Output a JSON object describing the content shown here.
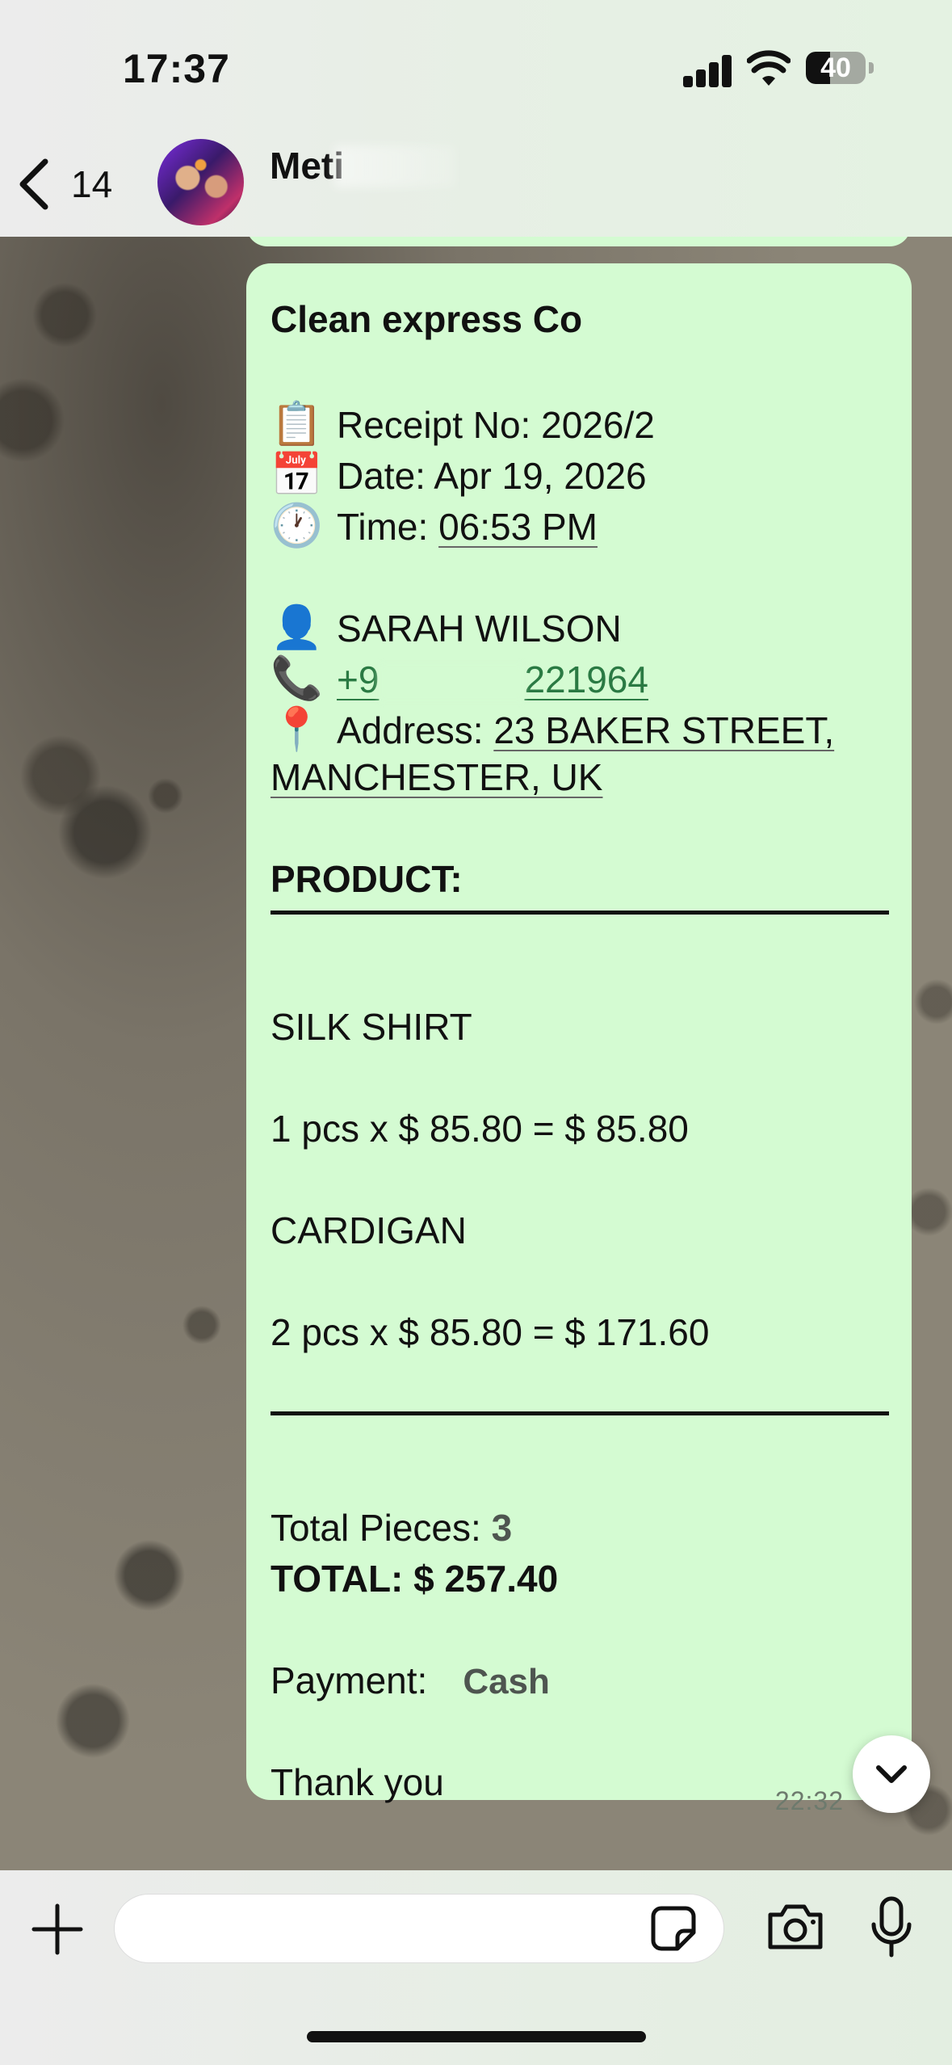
{
  "status_bar": {
    "time": "17:37",
    "battery": "40",
    "battery_level_percent": 40
  },
  "header": {
    "back_count": "14",
    "contact_name": "Meti"
  },
  "message": {
    "company": "Clean express Co",
    "receipt": {
      "emoji": "📋",
      "text": "Receipt No: 2026/2"
    },
    "date": {
      "emoji": "📅",
      "text": "Date: Apr 19, 2026"
    },
    "time": {
      "emoji": "🕐",
      "label": "Time: ",
      "value": "06:53 PM"
    },
    "customer": {
      "emoji": "👤",
      "name": "SARAH WILSON"
    },
    "phone": {
      "emoji": "📞",
      "prefix": "+9",
      "suffix": "221964"
    },
    "address": {
      "emoji": "📍",
      "label": "Address: ",
      "line1": "23 BAKER STREET,",
      "line2": "MANCHESTER, UK"
    },
    "product_heading": "PRODUCT:",
    "items": [
      {
        "name": "SILK SHIRT",
        "calc": "1 pcs x $ 85.80 = $ 85.80"
      },
      {
        "name": "CARDIGAN",
        "calc": "2 pcs x $ 85.80 = $ 171.60"
      }
    ],
    "total_pieces_label": "Total Pieces: ",
    "total_pieces_value": "3",
    "total": "TOTAL: $ 257.40",
    "payment_label": "Payment:",
    "payment_value": "Cash",
    "thanks": "Thank you",
    "timestamp": "22:32"
  },
  "colors": {
    "bubble": "#d4fbd2",
    "link": "#2a7a43"
  }
}
